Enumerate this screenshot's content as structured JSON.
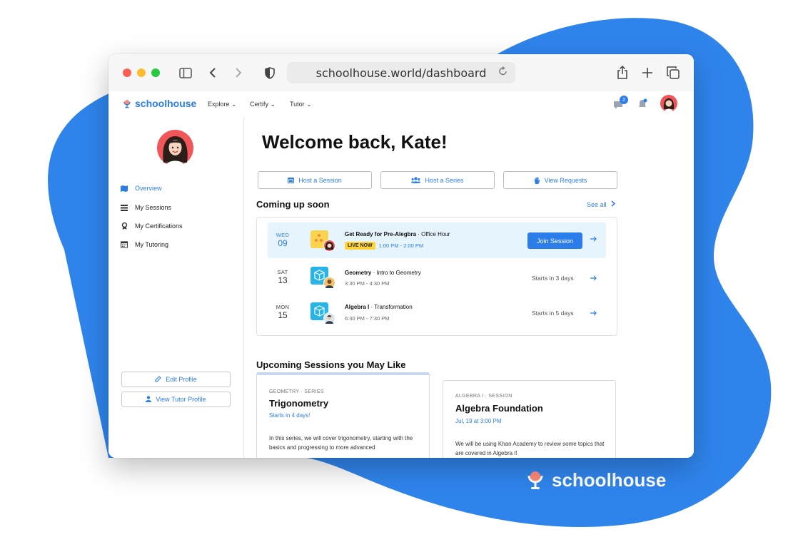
{
  "browser": {
    "url": "schoolhouse.world/dashboard"
  },
  "app": {
    "logo_text": "schoolhouse",
    "nav": [
      "Explore",
      "Certify",
      "Tutor"
    ],
    "messages_badge": "2"
  },
  "sidebar": {
    "items": [
      {
        "label": "Overview",
        "icon": "map-icon"
      },
      {
        "label": "My Sessions",
        "icon": "list-icon"
      },
      {
        "label": "My Certifications",
        "icon": "certificate-icon"
      },
      {
        "label": "My Tutoring",
        "icon": "calendar-icon"
      }
    ],
    "edit_profile": "Edit Profile",
    "view_tutor_profile": "View Tutor Profile"
  },
  "main": {
    "welcome": "Welcome back, Kate!",
    "actions": [
      "Host a Session",
      "Host a Series",
      "View Requests"
    ],
    "coming_up_title": "Coming up soon",
    "see_all": "See all",
    "sessions": [
      {
        "dow": "WED",
        "day": "09",
        "title": "Get Ready for Pre-Alegbra",
        "subtitle": " · Office Hour",
        "badge": "LIVE NOW",
        "time": "1:00 PM - 2:00 PM",
        "action": "Join Session"
      },
      {
        "dow": "SAT",
        "day": "13",
        "title": "Geometry",
        "subtitle": " · Intro to Geometry",
        "time": "3:30 PM - 4:30 PM",
        "status": "Starts in 3 days"
      },
      {
        "dow": "MON",
        "day": "15",
        "title": "Algebra I",
        "subtitle": " · Transformation",
        "time": "6:30 PM - 7:30 PM",
        "status": "Starts in 5 days"
      }
    ],
    "upcoming_title": "Upcoming Sessions you May Like",
    "cards": [
      {
        "tag": "GEOMETRY · SERIES",
        "title": "Trigonometry",
        "when": "Starts in 4 days!",
        "desc": "In this series, we will cover trigonometry, starting with the basics and progressing to more advanced"
      },
      {
        "tag": "ALGEBRA I · SESSION",
        "title": "Algebra Foundation",
        "when": "Jul, 19 at 3:00 PM",
        "desc": "We will be using Khan Academy to review some topics that are covered in Algebra I!"
      }
    ]
  },
  "footer": {
    "logo_text": "schoolhouse"
  },
  "colors": {
    "brand_blue": "#2b7de9",
    "live_bg": "#e6f4fd",
    "live_badge": "#ffd43b",
    "blob": "#2f84ec"
  }
}
